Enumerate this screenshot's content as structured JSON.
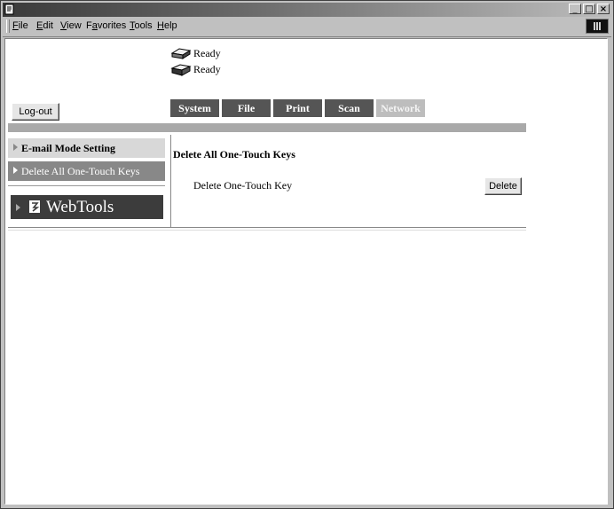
{
  "window": {
    "controls": [
      "_",
      "□",
      "×"
    ]
  },
  "menubar": {
    "items": [
      {
        "label": "File",
        "accel": "F"
      },
      {
        "label": "Edit",
        "accel": "E"
      },
      {
        "label": "View",
        "accel": "V"
      },
      {
        "label": "Favorites",
        "accel": "a"
      },
      {
        "label": "Tools",
        "accel": "T"
      },
      {
        "label": "Help",
        "accel": "H"
      }
    ]
  },
  "status": {
    "printer1": "Ready",
    "printer2": "Ready"
  },
  "header": {
    "logout_label": "Log-out",
    "tabs": [
      {
        "label": "System",
        "enabled": true
      },
      {
        "label": "File",
        "enabled": true
      },
      {
        "label": "Print",
        "enabled": true
      },
      {
        "label": "Scan",
        "enabled": true
      },
      {
        "label": "Network",
        "enabled": false
      }
    ]
  },
  "sidebar": {
    "items": [
      {
        "label": "E-mail Mode Setting"
      },
      {
        "label": "Delete All One-Touch Keys",
        "selected": true
      }
    ],
    "webtools_label": "WebTools"
  },
  "main": {
    "title": "Delete All One-Touch Keys",
    "row_label": "Delete One-Touch Key",
    "delete_label": "Delete"
  }
}
